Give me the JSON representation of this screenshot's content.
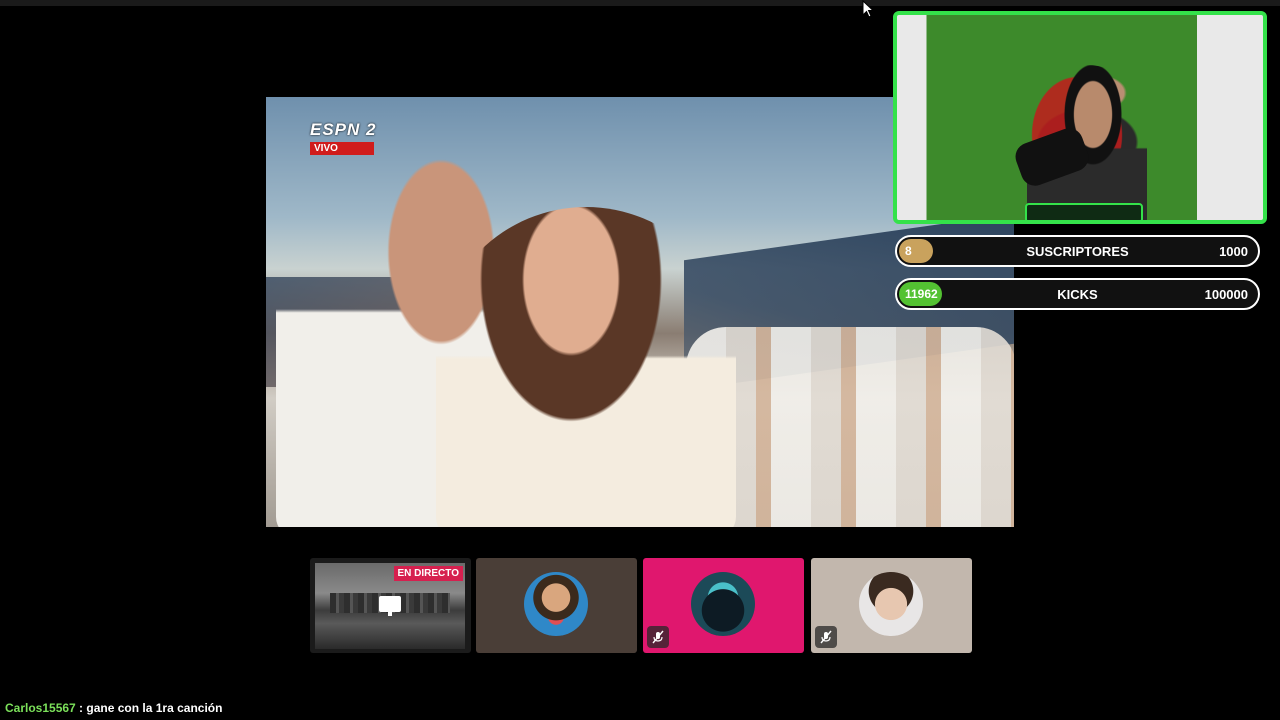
{
  "broadcast": {
    "network_logo": "ESPN 2",
    "live_tag": "VIVO"
  },
  "goals": [
    {
      "current": "8",
      "label": "SUSCRIPTORES",
      "target": "1000",
      "progress": 0.008,
      "color": "#c9a25d"
    },
    {
      "current": "11962",
      "label": "KICKS",
      "target": "100000",
      "progress": 0.12,
      "color": "#53c232"
    }
  ],
  "participants": [
    {
      "badge": "EN DIRECTO",
      "icon": "screen-share-icon"
    },
    {
      "icon": "avatar"
    },
    {
      "icon": "avatar",
      "muted": true
    },
    {
      "icon": "avatar",
      "muted": true
    }
  ],
  "chat": {
    "user": "Carlos15567",
    "separator": " : ",
    "message": "gane con la 1ra canción"
  },
  "colors": {
    "cam_border": "#34e24a",
    "tile_pink": "#e0176e",
    "live_badge": "#d6204f"
  }
}
